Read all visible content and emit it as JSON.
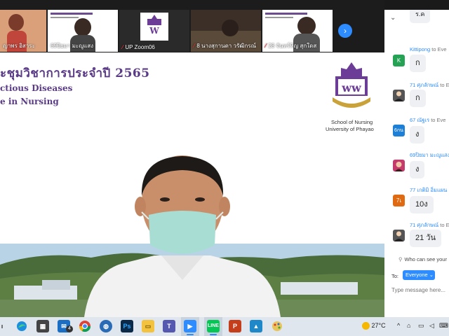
{
  "thumbnails": [
    {
      "name": "ญาพร อิสาระ",
      "muted": false
    },
    {
      "name": "69ปิยมา มะญูแสง",
      "muted": false
    },
    {
      "name": "UP Zoom06",
      "muted": true
    },
    {
      "name": "8 นางสุกานดา วรัฒิกรณ์",
      "muted": true
    },
    {
      "name": "28 จันทร์ทิญ สุกใดส",
      "muted": true
    }
  ],
  "next_page_icon": "chevron-right",
  "slide": {
    "title": "ะชุมวิชาการประจำปี 2565",
    "subtitle1": "ctious Diseases",
    "subtitle2": "e in Nursing",
    "school_line1": "School of Nursing",
    "school_line2": "University of Phayao",
    "logo_text": "มหาวิทยาลัยพะเยา"
  },
  "chat": {
    "top_partial": "ร.ค",
    "messages": [
      {
        "sender": "Kittipong",
        "to": "to Eve",
        "avatar": "K",
        "avatar_color": "#26a255",
        "text": "ก"
      },
      {
        "sender": "71 ศุภลักษณ์",
        "to": "to E",
        "avatar": "",
        "avatar_color": "#555555",
        "text": "ก"
      },
      {
        "sender": "67 ณัฐเร",
        "to": "to Eve",
        "avatar": "6กน",
        "avatar_color": "#1e7fd6",
        "text": "ง"
      },
      {
        "sender": "69ปิยมา มะญูแสง",
        "to": "",
        "avatar": "",
        "avatar_color": "#c43a6a",
        "text": "ง"
      },
      {
        "sender": "77 เกติมิ อิ่มแผน",
        "to": "",
        "avatar": "7เ",
        "avatar_color": "#e06a12",
        "text": "10ง"
      },
      {
        "sender": "71 ศุภลักษณ์",
        "to": "to E",
        "avatar": "",
        "avatar_color": "#555555",
        "text": "21 วัน"
      }
    ],
    "who_can_see": "Who can see your",
    "to_label": "To:",
    "recipient": "Everyone",
    "input_placeholder": "Type message here..."
  },
  "taskbar": {
    "temperature": "27°C",
    "badge_count": "4"
  }
}
